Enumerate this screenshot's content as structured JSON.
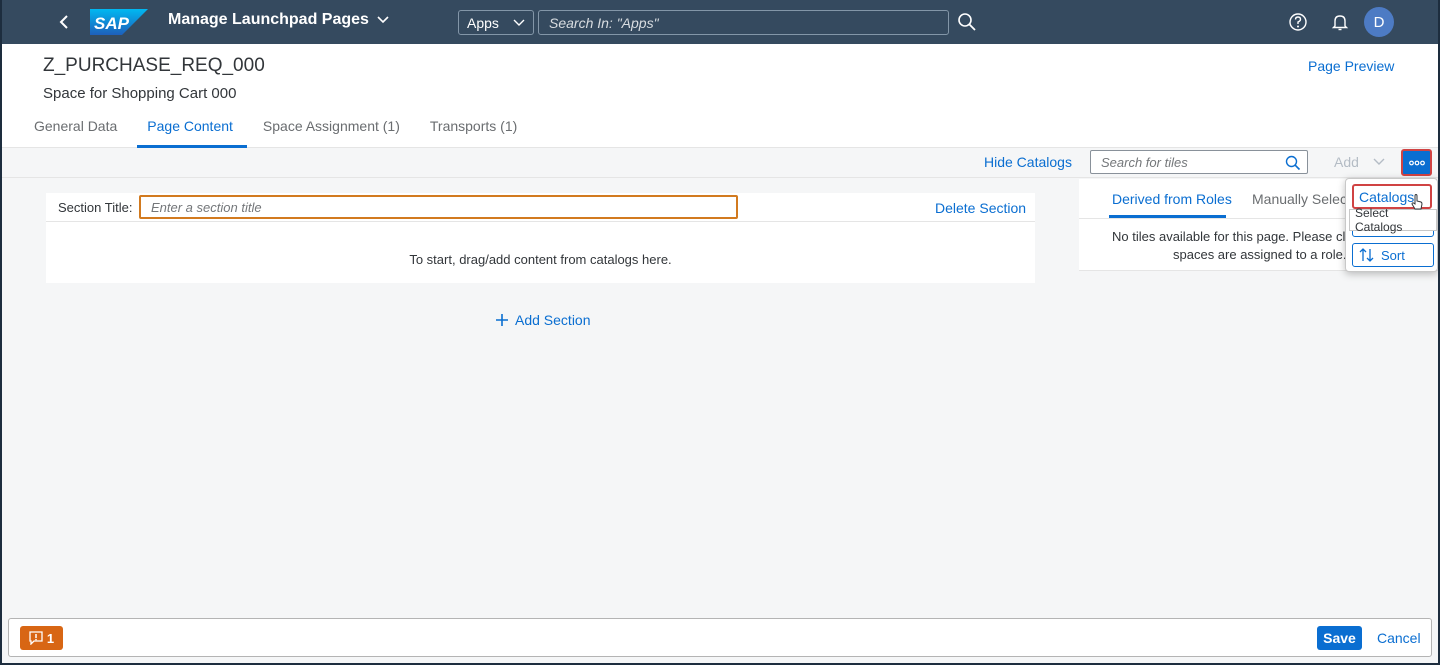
{
  "shell": {
    "logo_text": "SAP",
    "app_title": "Manage Launchpad Pages",
    "search_scope": "Apps",
    "search_placeholder": "Search In: \"Apps\"",
    "avatar_initial": "D"
  },
  "page": {
    "id": "Z_PURCHASE_REQ_000",
    "description": "Space for Shopping Cart 000",
    "preview_link": "Page Preview"
  },
  "tabs": [
    {
      "label": "General Data",
      "active": false
    },
    {
      "label": "Page Content",
      "active": true
    },
    {
      "label": "Space Assignment (1)",
      "active": false
    },
    {
      "label": "Transports (1)",
      "active": false
    }
  ],
  "toolbar": {
    "hide_catalogs": "Hide Catalogs",
    "tile_search_placeholder": "Search for tiles",
    "add_label": "Add"
  },
  "section": {
    "title_label": "Section Title:",
    "title_placeholder": "Enter a section title",
    "delete_label": "Delete Section",
    "empty_message": "To start, drag/add content from catalogs here.",
    "add_section_label": "Add Section"
  },
  "catalog_panel": {
    "tabs": [
      "Derived from Roles",
      "Manually Select"
    ],
    "message_line1": "No tiles available for this page. Please cl",
    "message_line2": "spaces are assigned to a role."
  },
  "overflow_menu": {
    "catalogs_label": "Catalogs",
    "tooltip": "Select Catalogs",
    "sort_label": "Sort"
  },
  "footer": {
    "message_count": "1",
    "save_label": "Save",
    "cancel_label": "Cancel"
  },
  "colors": {
    "shell": "#354a5f",
    "accent": "#0a6ed1",
    "warning": "#d86614",
    "highlight_border": "#d04343"
  }
}
